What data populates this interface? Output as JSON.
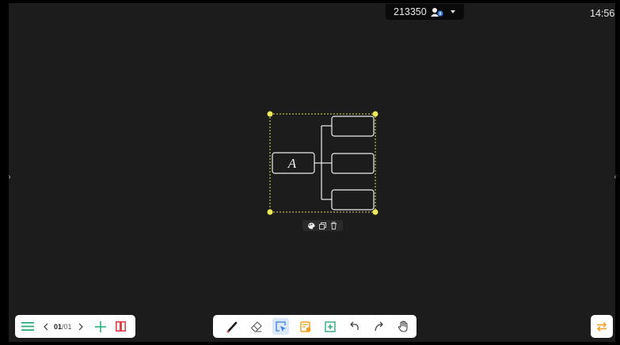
{
  "header": {
    "session_code": "213350",
    "clock": "14:56"
  },
  "mindmap": {
    "root_label": "A",
    "child_count": 3
  },
  "page_nav": {
    "current": "01",
    "separator": "/",
    "total": "01"
  },
  "icons": {
    "menu": "menu-icon",
    "prev": "chevron-left-icon",
    "next": "chevron-right-icon",
    "add_page": "plus-icon",
    "pages_view": "pages-view-icon",
    "pen": "pen-icon",
    "eraser": "eraser-icon",
    "select": "select-icon",
    "note": "sticky-note-icon",
    "insert": "insert-icon",
    "undo": "undo-icon",
    "redo": "redo-icon",
    "hand": "hand-icon",
    "switch": "switch-side-icon"
  },
  "colors": {
    "accent_green": "#2fae7a",
    "accent_red": "#e0404a",
    "accent_orange": "#f0a020",
    "accent_blue": "#3b7de0",
    "selection": "#e6e04a"
  },
  "tools": {
    "active": "select"
  }
}
